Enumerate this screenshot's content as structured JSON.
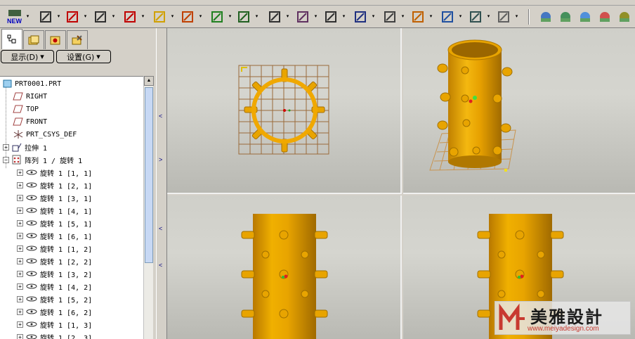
{
  "toolbar": {
    "new_label": "NEW",
    "icons": [
      "new-file-icon",
      "datum-plane-icon",
      "datum-axis-icon",
      "datum-curve-icon",
      "datum-point-icon",
      "sketch-pencil-icon",
      "sketch-tool-icon",
      "extrude-icon",
      "revolve-icon",
      "hole-icon",
      "round-icon",
      "chamfer-icon",
      "rib-icon",
      "shell-icon",
      "draft-icon",
      "pattern-icon",
      "mirror-icon",
      "view-orient-icon",
      "repaint-icon",
      "spin-center-icon",
      "appearance-icon",
      "model-tree-icon",
      "layer-icon"
    ]
  },
  "tabs": [
    "model-tree-tab",
    "folder-browser-tab",
    "favorites-tab",
    "connections-tab"
  ],
  "display_button": "显示(D)",
  "settings_button": "设置(G)",
  "tree": {
    "root": "PRT0001.PRT",
    "items": [
      {
        "label": "RIGHT",
        "kind": "datum-plane"
      },
      {
        "label": "TOP",
        "kind": "datum-plane"
      },
      {
        "label": "FRONT",
        "kind": "datum-plane"
      },
      {
        "label": "PRT_CSYS_DEF",
        "kind": "csys"
      },
      {
        "label": "拉伸 1",
        "kind": "extrude"
      },
      {
        "label": "阵列 1 / 旋转 1",
        "kind": "pattern"
      }
    ],
    "pattern_children": [
      "旋转 1 [1, 1]",
      "旋转 1 [2, 1]",
      "旋转 1 [3, 1]",
      "旋转 1 [4, 1]",
      "旋转 1 [5, 1]",
      "旋转 1 [6, 1]",
      "旋转 1 [1, 2]",
      "旋转 1 [2, 2]",
      "旋转 1 [3, 2]",
      "旋转 1 [4, 2]",
      "旋转 1 [5, 2]",
      "旋转 1 [6, 2]",
      "旋转 1 [1, 3]",
      "旋转 1 [2, 3]"
    ]
  },
  "watermark": {
    "brand": "美雅設計",
    "url": "www.meiyadesign.com"
  },
  "colors": {
    "part": "#e8a400",
    "part_dark": "#b07800",
    "grid": "#9a6a3a",
    "chrome": "#d4d0c8"
  }
}
